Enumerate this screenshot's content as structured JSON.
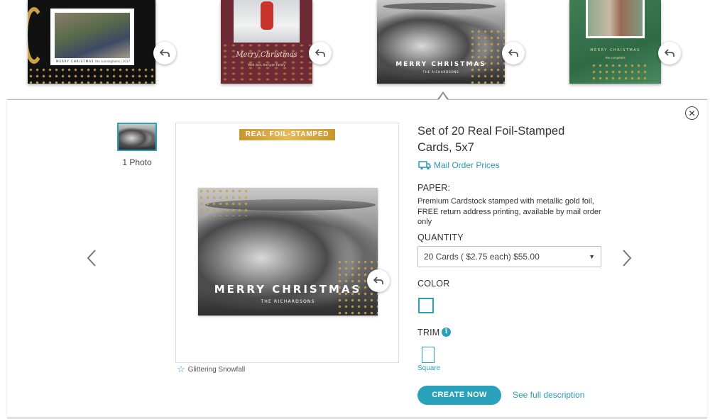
{
  "carousel": {
    "cards": [
      {
        "greeting": "MERRY CHRISTMAS",
        "signature": "the cunninghams | 2017"
      },
      {
        "greeting": "Merry Christmas",
        "signature": "With love, the Lyon Family"
      },
      {
        "greeting": "MERRY CHRISTMAS",
        "signature": "THE RICHARDSONS"
      },
      {
        "greeting": "MERRY CHRISTMAS",
        "signature": "the campbells"
      }
    ],
    "flip_icon": "flip-arrow-icon"
  },
  "panel": {
    "close_icon": "close-icon",
    "side_thumbnail": {
      "count_label": "1 Photo"
    },
    "preview": {
      "badge": "REAL FOIL-STAMPED",
      "card_greeting": "MERRY CHRISTMAS",
      "card_signature": "THE RICHARDSONS",
      "design_name": "Glittering Snowfall",
      "favorite_icon": "star-outline-icon"
    },
    "details": {
      "title": "Set of 20 Real Foil-Stamped Cards, 5x7",
      "mail_order_link": "Mail Order Prices",
      "paper_label": "PAPER:",
      "paper_description": "Premium Cardstock stamped with metallic gold foil, FREE return address printing, available by mail order only",
      "quantity_label": "QUANTITY",
      "quantity_selected": "20 Cards ( $2.75 each) $55.00",
      "color_label": "COLOR",
      "trim_label": "TRIM",
      "trim_option": "Square",
      "create_button": "CREATE NOW",
      "full_description_link": "See full description"
    },
    "nav": {
      "prev_icon": "chevron-left-icon",
      "next_icon": "chevron-right-icon"
    }
  },
  "colors": {
    "accent": "#2aa1ba",
    "foil_gold": "#c8962e",
    "text": "#333333"
  }
}
